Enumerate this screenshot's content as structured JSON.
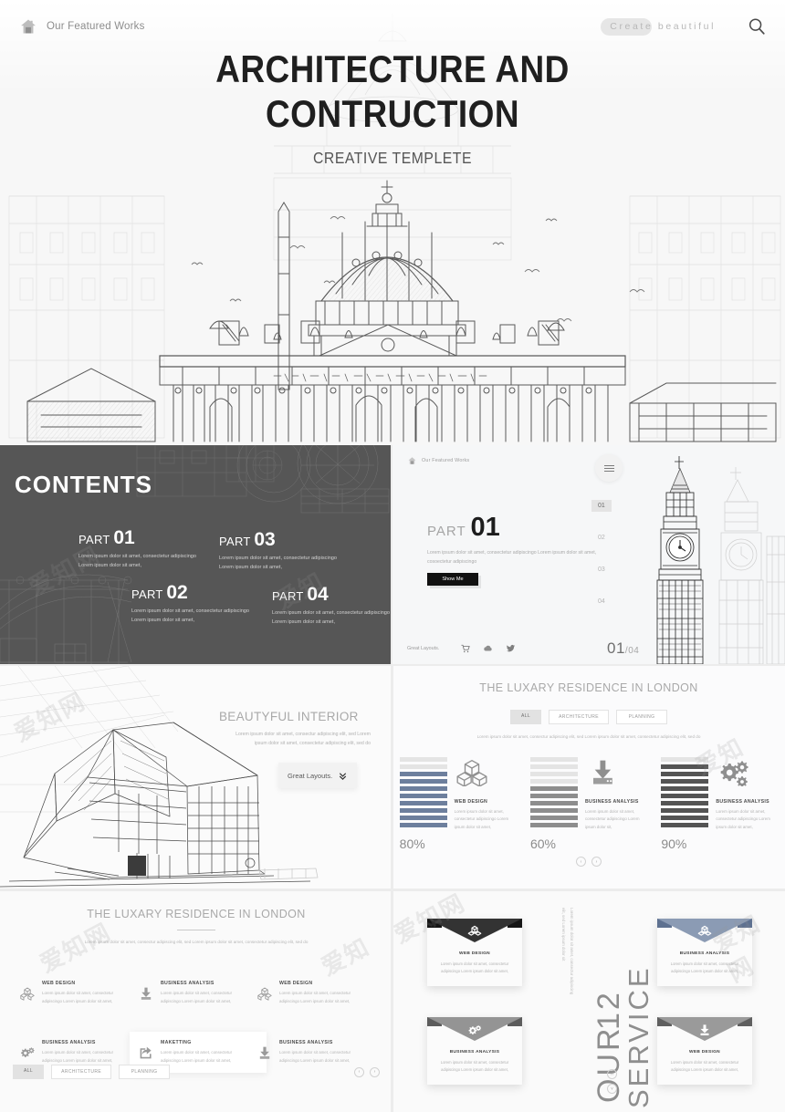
{
  "hero": {
    "brand": "Our Featured Works",
    "tagline": "Create beautiful",
    "title_line1": "ARCHITECTURE AND",
    "title_line2": "CONTRUCTION",
    "subtitle": "CREATIVE TEMPLETE",
    "home_icon": "home-icon",
    "search_icon": "search-icon"
  },
  "contents": {
    "heading": "CONTENTS",
    "parts": [
      {
        "label": "PART",
        "num": "01",
        "text": "Lorem ipsum dolor sit amet, consectetur adipiscingo Lorem ipsum dolor sit amet,"
      },
      {
        "label": "PART",
        "num": "02",
        "text": "Lorem ipsum dolor sit amet, consectetur adipiscingo Lorem ipsum dolor sit amet,"
      },
      {
        "label": "PART",
        "num": "03",
        "text": "Lorem ipsum dolor sit amet, consectetur adipiscingo Lorem ipsum dolor sit amet,"
      },
      {
        "label": "PART",
        "num": "04",
        "text": "Lorem ipsum dolor sit amet, consectetur adipiscingo Lorem ipsum dolor sit amet,"
      }
    ]
  },
  "part01": {
    "brand": "Our Featured Works",
    "label": "PART",
    "num": "01",
    "desc": "Lorem ipsum dolor sit amet, consectetur adipiscingo Lorem ipsum dolor sit amet, cosoectetur adipiscingo",
    "button": "Show Me",
    "nav": [
      "01",
      "02",
      "03",
      "04"
    ],
    "nav_active": "01",
    "footer_label": "Great Layouts.",
    "counter_current": "01",
    "counter_total": "/04",
    "footer_icons": [
      "cart-icon",
      "cloud-icon",
      "twitter-icon"
    ],
    "menu_icon": "hamburger-icon"
  },
  "interior": {
    "title_bold": "BEAUTYFUL",
    "title_light": " INTERIOR",
    "desc": "Lorem ipsum dolor sit amet, consectur adipiscing elit, sed Lorem ipsum dolor sit amet, consectetur adipiscing elit, sed do",
    "box_label": "Great Layouts.",
    "box_icon": "chevrons-down-icon"
  },
  "luxbars": {
    "title_bold": "THE LUXARY",
    "title_light": " RESIDENCE IN LONDON",
    "filters": [
      {
        "label": "ALL",
        "active": true
      },
      {
        "label": "ARCHITECTURE",
        "active": false
      },
      {
        "label": "PLANNING",
        "active": false
      }
    ],
    "desc": "Lorem ipsum dolor sit amet, consectur adipiscing elit, sed Lorem ipsum dolor sit amet, consectetur adipiscing elit, sed do",
    "prev_icon": "chevron-left-icon",
    "next_icon": "chevron-right-icon"
  },
  "chart_data": {
    "type": "bar",
    "title": "THE LUXARY RESIDENCE IN LONDON",
    "categories": [
      "WEB DESIGN",
      "BUSINESS ANALYSIS",
      "BUSINESS ANALYSIS"
    ],
    "values": [
      80,
      60,
      90
    ],
    "value_labels": [
      "80%",
      "60%",
      "90%"
    ],
    "segments_total": 10,
    "segment_colors": [
      "#6d7f9d",
      "#8d8d8d",
      "#545454"
    ],
    "empty_color": "#e4e4e4",
    "ylabel": "",
    "xlabel": "",
    "ylim": [
      0,
      100
    ],
    "series": [
      {
        "name": "WEB DESIGN",
        "value": 80,
        "filled_segments": 8,
        "color": "#6d7f9d",
        "icon": "boxes-icon",
        "text": "Lorem ipsum dolor sit amet, consectetur adipiscingo Lorem ipsum dolor sit amet,"
      },
      {
        "name": "BUSINESS ANALYSIS",
        "value": 60,
        "filled_segments": 6,
        "color": "#8d8d8d",
        "icon": "download-icon",
        "text": "Lorem ipsum dolor sit amet, consectetur adipiscingo Lorem ipsum dolor sit,"
      },
      {
        "name": "BUSINESS ANALYSIS",
        "value": 90,
        "filled_segments": 9,
        "color": "#545454",
        "icon": "gears-icon",
        "text": "Lorem ipsum dolor sit amet, consectetur adipiscingo Lorem ipsum dolor sit amet,"
      }
    ]
  },
  "luxlist": {
    "title_bold": "THE LUXARY",
    "title_light": " RESIDENCE IN LONDON",
    "desc": "Lorem ipsum dolor sit amet, consectur adipiscing elit, sed Lorem ipsum dolor sit amet, consectetur adipiscing elit, sed do",
    "items": [
      {
        "icon": "boxes-icon",
        "title": "WEB DESIGN",
        "text": "Lorem ipsum dolor sit amet, consectetur adipiscingo Lorem ipsum dolor sit amet,",
        "highlight": false
      },
      {
        "icon": "download-icon",
        "title": "BUSINESS ANALYSIS",
        "text": "Lorem ipsum dolor sit amet, consectetur adipiscingo Lorem ipsum dolor sit amet,",
        "highlight": false
      },
      {
        "icon": "boxes-icon",
        "title": "WEB DESIGN",
        "text": "Lorem ipsum dolor sit amet, consectetur adipiscingo Lorem ipsum dolor sit amet,",
        "highlight": false
      },
      {
        "icon": "gears-icon",
        "title": "BUSINESS ANALYSIS",
        "text": "Lorem ipsum dolor sit amet, consectetur adipiscingo Lorem ipsum dolor sit amet,",
        "highlight": false
      },
      {
        "icon": "share-icon",
        "title": "MAKETTING",
        "text": "Lorem ipsum dolor sit amet, consectetur adipiscingo Lorem ipsum dolor sit amet,",
        "highlight": true
      },
      {
        "icon": "download-icon",
        "title": "BUSINESS ANALYSIS",
        "text": "Lorem ipsum dolor sit amet, consectetur adipiscingo Lorem ipsum dolor sit amet,",
        "highlight": false
      }
    ],
    "filters": [
      {
        "label": "ALL",
        "active": true
      },
      {
        "label": "ARCHITECTURE",
        "active": false
      },
      {
        "label": "PLANNING",
        "active": false
      }
    ],
    "prev_icon": "chevron-left-icon",
    "next_icon": "chevron-right-icon"
  },
  "service": {
    "vertical_word1": "OUR",
    "vertical_num": "12",
    "vertical_word2": "SERVICE",
    "vertical_desc": "Lorem ipsum dolor sit amet, consectur adipiscing elit, sed Lorem ipsum dolor sit",
    "up_icon": "chevron-up-icon",
    "down_icon": "chevron-down-icon",
    "cards": [
      {
        "title": "WEB DESIGN",
        "text": "Lorem ipsum dolor sit amet, consectetur adipiscingo Lorem ipsum dolor sit amet,",
        "icon": "boxes-icon",
        "flap": "#333333",
        "flap_side": "#151515"
      },
      {
        "title": "BUSINESS ANALYSIS",
        "text": "Lorem ipsum dolor sit amet, consectetur adipiscingo Lorem ipsum dolor sit amet,",
        "icon": "boxes-icon",
        "flap": "#8b9bb4",
        "flap_side": "#5e7architecture"
      },
      {
        "title": "BUSINESS ANALYSIS",
        "text": "Lorem ipsum dolor sit amet, consectetur adipiscingo Lorem ipsum dolor sit amet,",
        "icon": "gears-icon",
        "flap": "#949494",
        "flap_side": "#5c5c5c"
      },
      {
        "title": "WEB DESIGN",
        "text": "Lorem ipsum dolor sit amet, consectetur adipiscingo Lorem ipsum dolor sit amet,",
        "icon": "download-icon",
        "flap": "#9a9a9a",
        "flap_side": "#5f5f5f"
      }
    ]
  },
  "colors": {
    "accent_blue": "#6d7f9d",
    "dark": "#222222",
    "contents_bg": "#565656",
    "page_bg": "#ffffff"
  }
}
